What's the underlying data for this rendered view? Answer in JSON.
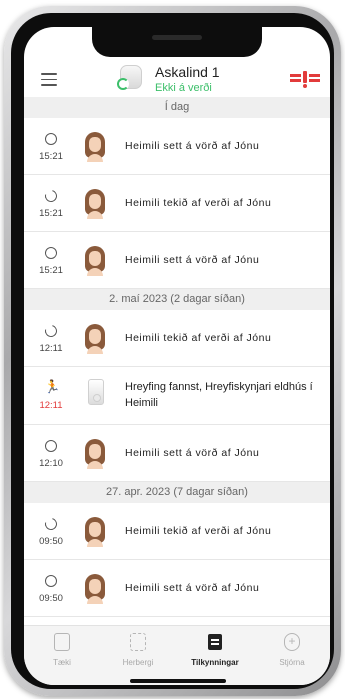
{
  "header": {
    "panel_name": "Askalind 1",
    "panel_status": "Ekki á verði",
    "menu_icon": "hamburger-menu-icon",
    "device_icon": "security-panel-icon",
    "brand_icon": "brand-logo-icon"
  },
  "sections": [
    {
      "date": "Í dag",
      "items": [
        {
          "icon": "armed-circle-icon",
          "time": "15:21",
          "message": "Heimili sett á vörð af Jónu",
          "avatar": "user-avatar"
        },
        {
          "icon": "disarmed-circle-icon",
          "time": "15:21",
          "message": "Heimili tekið af verði af Jónu",
          "avatar": "user-avatar"
        },
        {
          "icon": "armed-circle-icon",
          "time": "15:21",
          "message": "Heimili sett á vörð af Jónu",
          "avatar": "user-avatar"
        }
      ]
    },
    {
      "date": "2. maí 2023 (2 dagar síðan)",
      "items": [
        {
          "icon": "disarmed-circle-icon",
          "time": "12:11",
          "message": "Heimili tekið af verði af Jónu",
          "avatar": "user-avatar"
        },
        {
          "icon": "motion-runner-icon",
          "time": "12:11",
          "message": "Hreyfing fannst, Hreyfiskynjari eldhús í Heimili",
          "avatar": "motion-sensor-image"
        },
        {
          "icon": "armed-circle-icon",
          "time": "12:10",
          "message": "Heimili sett á vörð af Jónu",
          "avatar": "user-avatar"
        }
      ]
    },
    {
      "date": "27. apr. 2023 (7 dagar síðan)",
      "items": [
        {
          "icon": "disarmed-circle-icon",
          "time": "09:50",
          "message": "Heimili tekið af verði af Jónu",
          "avatar": "user-avatar"
        },
        {
          "icon": "armed-circle-icon",
          "time": "09:50",
          "message": "Heimili sett á vörð af Jónu",
          "avatar": "user-avatar"
        }
      ]
    }
  ],
  "nav": {
    "items": [
      {
        "label": "Tæki",
        "icon": "devices-icon",
        "active": false
      },
      {
        "label": "Herbergi",
        "icon": "rooms-icon",
        "active": false
      },
      {
        "label": "Tilkynningar",
        "icon": "notifications-icon",
        "active": true
      },
      {
        "label": "Stjórna",
        "icon": "control-icon",
        "active": false
      }
    ]
  },
  "colors": {
    "status_green": "#3cbf6a",
    "alert_red": "#e23b3b",
    "section_bg": "#efefef"
  }
}
